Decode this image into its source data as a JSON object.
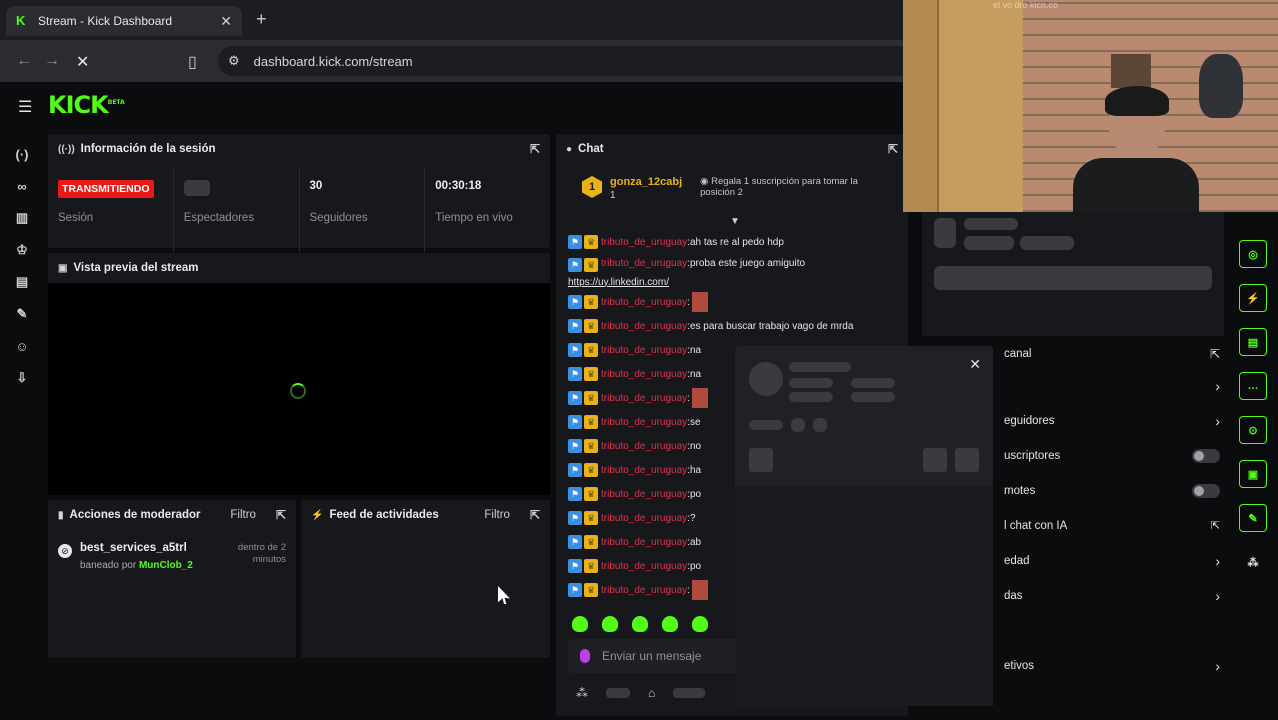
{
  "browser": {
    "tab_title": "Stream - Kick Dashboard",
    "tab_close": "✕",
    "new_tab": "+",
    "url": "dashboard.kick.com/stream",
    "back": "←",
    "forward": "→",
    "stop": "✕"
  },
  "header": {
    "logo": "KICK",
    "logo_badge": "BETA"
  },
  "session": {
    "title": "Información de la sesión",
    "status_badge": "TRANSMITIENDO",
    "status_label": "Sesión",
    "viewers_label": "Espectadores",
    "followers_value": "30",
    "followers_label": "Seguidores",
    "live_time_value": "00:30:18",
    "live_time_label": "Tiempo en vivo"
  },
  "preview": {
    "title": "Vista previa del stream"
  },
  "mod_actions": {
    "title": "Acciones de moderador",
    "filter": "Filtro",
    "entry": {
      "user": "best_services_a5trl",
      "by_prefix": "baneado por",
      "by_user": "MunClob_2",
      "time": "dentro de 2 minutos"
    }
  },
  "activity": {
    "title": "Feed de actividades",
    "filter": "Filtro"
  },
  "chat": {
    "title": "Chat",
    "pinned": {
      "badge": "1",
      "user": "gonza_12cabj",
      "count": "1",
      "rule": "Regala 1 suscripción para tomar la posición 2"
    },
    "username": "tributo_de_uruguay",
    "messages": [
      {
        "text": "ah tas re al pedo hdp"
      },
      {
        "text": "proba este juego amiguito",
        "link": "https://uy.linkedin.com/"
      },
      {
        "text": "",
        "emote": true
      },
      {
        "text": "es para buscar trabajo vago de mrda"
      },
      {
        "text": "na"
      },
      {
        "text": "na"
      },
      {
        "text": "",
        "emote": true
      },
      {
        "text": "se"
      },
      {
        "text": "no"
      },
      {
        "text": "ha"
      },
      {
        "text": "po"
      },
      {
        "text": "?"
      },
      {
        "text": "ab"
      },
      {
        "text": "po"
      },
      {
        "text": "",
        "emote": true
      }
    ],
    "input_placeholder": "Enviar un mensaje"
  },
  "settings": {
    "title": "canal",
    "rows": [
      {
        "label": "",
        "kind": "chevron"
      },
      {
        "label": "eguidores",
        "kind": "chevron"
      },
      {
        "label": "uscriptores",
        "kind": "toggle"
      },
      {
        "label": "motes",
        "kind": "toggle"
      },
      {
        "label": "l chat con IA",
        "kind": "ext"
      },
      {
        "label": "edad",
        "kind": "chevron"
      },
      {
        "label": "das",
        "kind": "chevron"
      },
      {
        "label": "",
        "kind": "none"
      },
      {
        "label": "etivos",
        "kind": "chevron"
      }
    ]
  },
  "webcam": {
    "watermark": "el vo dro kicn.co"
  },
  "colors": {
    "brand": "#53fc18",
    "live": "#e91916",
    "username": "#e0324c",
    "gold": "#e8b21b"
  }
}
